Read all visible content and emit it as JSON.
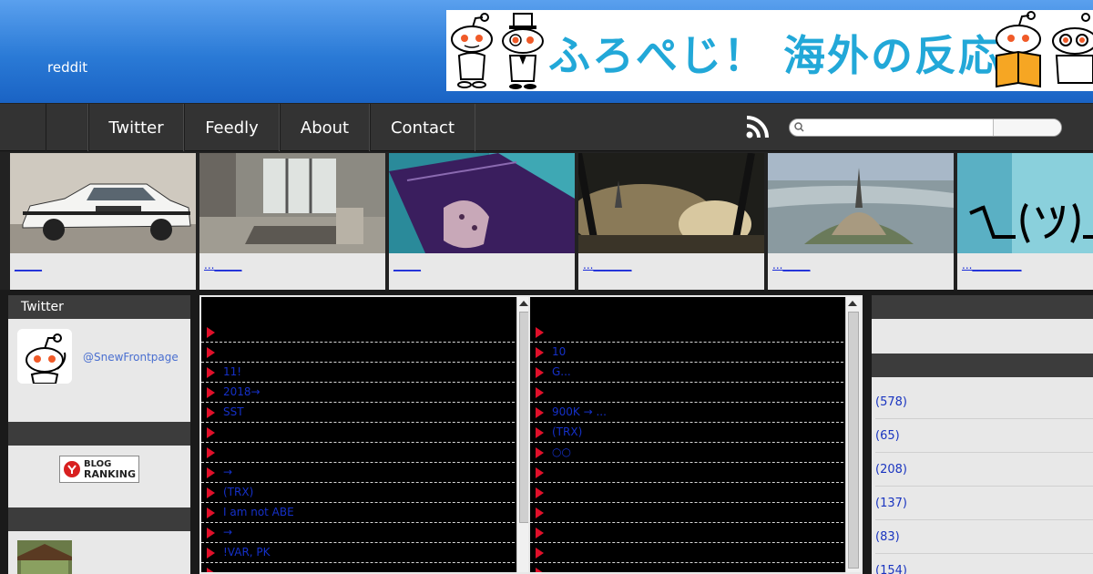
{
  "site": {
    "title": "reddit"
  },
  "banner": {
    "text": "ふろぺじ！ 海外の反応"
  },
  "nav": {
    "items": [
      {
        "label": ""
      },
      {
        "label": "Twitter"
      },
      {
        "label": "Feedly"
      },
      {
        "label": "About"
      },
      {
        "label": "Contact"
      }
    ],
    "search_placeholder": ""
  },
  "thumbs": [
    {
      "link": "_____"
    },
    {
      "link": "..._____"
    },
    {
      "link": "_____"
    },
    {
      "link": "..._______"
    },
    {
      "link": "..._____"
    },
    {
      "link": "..._________"
    }
  ],
  "left_sidebar": {
    "twitter_heading": "Twitter",
    "twitter_handle": "@SnewFrontpage",
    "ranking_label_1": "BLOG",
    "ranking_label_2": "RANKING"
  },
  "feed_left": [
    {
      "text": ""
    },
    {
      "text": ""
    },
    {
      "text": "11!"
    },
    {
      "text": "2018→"
    },
    {
      "text": "SST"
    },
    {
      "text": ""
    },
    {
      "text": ""
    },
    {
      "text": "→"
    },
    {
      "text": "(TRX)"
    },
    {
      "text": "I am not ABE"
    },
    {
      "text": "→"
    },
    {
      "text": "!VAR, PK"
    },
    {
      "text": ""
    }
  ],
  "feed_right": [
    {
      "text": ""
    },
    {
      "text": "10"
    },
    {
      "text": "G..."
    },
    {
      "text": ""
    },
    {
      "text": "900K → ..."
    },
    {
      "text": "(TRX)"
    },
    {
      "text": "○○"
    },
    {
      "text": ""
    },
    {
      "text": ""
    },
    {
      "text": ""
    },
    {
      "text": ""
    },
    {
      "text": ""
    },
    {
      "text": ""
    }
  ],
  "right_sidebar": {
    "counts": [
      "(578)",
      "(65)",
      "(208)",
      "(137)",
      "(83)",
      "(154)"
    ]
  },
  "colors": {
    "header_blue": "#2a7ad6",
    "nav_bg": "#333333",
    "feed_text": "#1530c8",
    "feed_arrow": "#e0102a",
    "banner_text": "#22a8d8"
  }
}
